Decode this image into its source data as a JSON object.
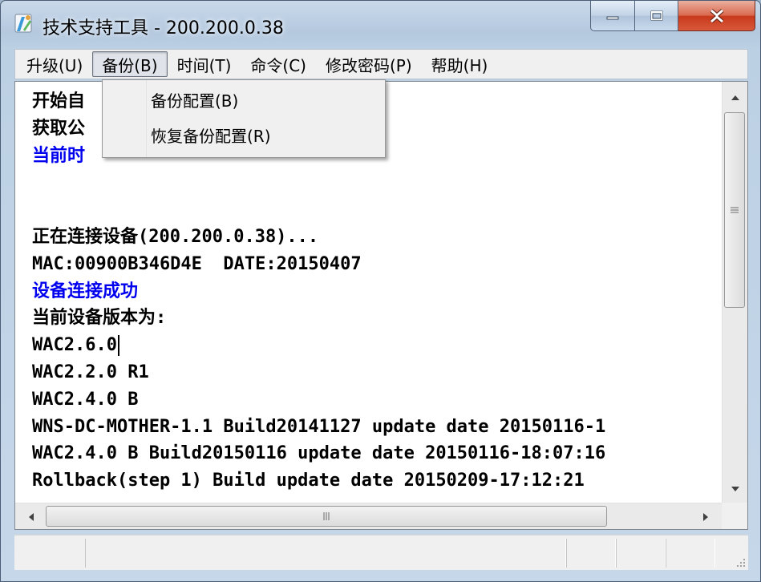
{
  "window": {
    "title": "技术支持工具 - 200.200.0.38"
  },
  "menubar": {
    "items": [
      {
        "label": "升级(U)"
      },
      {
        "label": "备份(B)"
      },
      {
        "label": "时间(T)"
      },
      {
        "label": "命令(C)"
      },
      {
        "label": "修改密码(P)"
      },
      {
        "label": "帮助(H)"
      }
    ]
  },
  "backup_menu": {
    "items": [
      {
        "label": "备份配置(B)"
      },
      {
        "label": "恢复备份配置(R)"
      }
    ]
  },
  "log": {
    "lines": [
      {
        "text": "开始自",
        "color": "#000000"
      },
      {
        "text": "获取公",
        "color": "#000000"
      },
      {
        "text": "当前时",
        "color": "#0000ee"
      },
      {
        "text": "",
        "color": "#000000"
      },
      {
        "text": "",
        "color": "#000000"
      },
      {
        "text": "正在连接设备(200.200.0.38)...",
        "color": "#000000"
      },
      {
        "text": "MAC:00900B346D4E  DATE:20150407",
        "color": "#000000"
      },
      {
        "text": "设备连接成功",
        "color": "#0000ee"
      },
      {
        "text": "当前设备版本为:",
        "color": "#000000"
      },
      {
        "text": "WAC2.6.0",
        "color": "#000000"
      },
      {
        "text": "WAC2.2.0 R1",
        "color": "#000000"
      },
      {
        "text": "WAC2.4.0 B",
        "color": "#000000"
      },
      {
        "text": "WNS-DC-MOTHER-1.1 Build20141127 update date 20150116-1",
        "color": "#000000"
      },
      {
        "text": "WAC2.4.0 B Build20150116 update date 20150116-18:07:16",
        "color": "#000000"
      },
      {
        "text": "Rollback(step 1) Build update date 20150209-17:12:21",
        "color": "#000000"
      }
    ]
  },
  "colors": {
    "accent_blue": "#0000ee",
    "close_button": "#c8381b"
  },
  "icons": {
    "app": "tool-app-icon",
    "minimize": "minimize-icon",
    "maximize": "maximize-icon",
    "close": "close-icon"
  }
}
